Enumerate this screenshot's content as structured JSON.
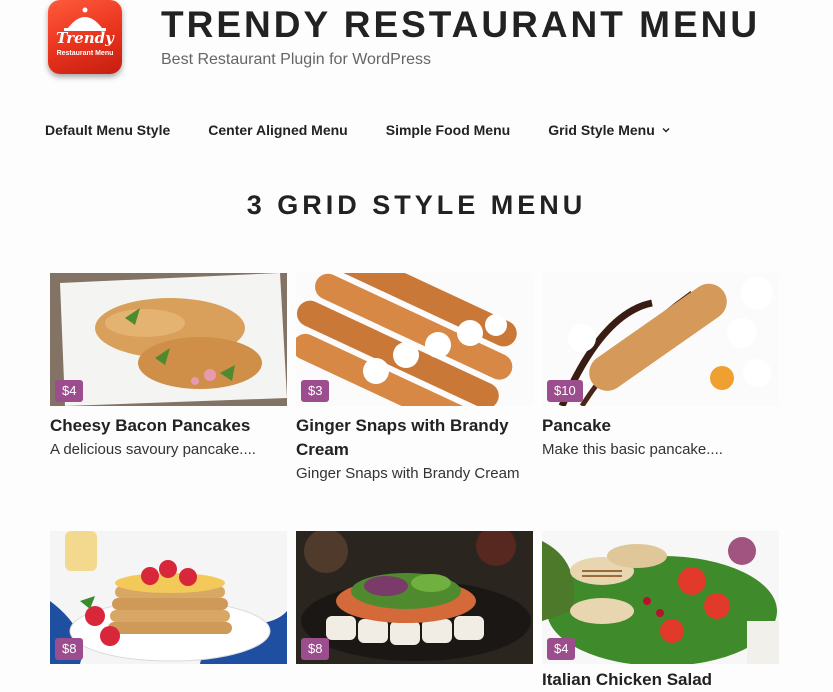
{
  "site": {
    "title": "TRENDY RESTAURANT MENU",
    "tagline": "Best Restaurant Plugin for WordPress",
    "logo_script": "Trendy",
    "logo_sub": "Restaurant Menu"
  },
  "nav": {
    "items": [
      {
        "label": "Default Menu Style"
      },
      {
        "label": "Center Aligned Menu"
      },
      {
        "label": "Simple Food Menu"
      },
      {
        "label": "Grid Style Menu",
        "has_dropdown": true
      }
    ]
  },
  "page": {
    "title": "3 GRID STYLE MENU"
  },
  "colors": {
    "price_badge": "#9b4d8e"
  },
  "menu_items": [
    {
      "title": "Cheesy Bacon Pancakes",
      "description": "A delicious savoury pancake....",
      "price": "$4",
      "image": "cheesy-bacon-pancakes-image"
    },
    {
      "title": "Ginger Snaps with Brandy Cream",
      "description": "Ginger Snaps with Brandy Cream",
      "price": "$3",
      "image": "ginger-snaps-image"
    },
    {
      "title": "Pancake",
      "description": "Make this basic pancake....",
      "price": "$10",
      "image": "pancake-image"
    },
    {
      "title": "",
      "description": "",
      "price": "$8",
      "image": "pancake-stack-raspberries-image"
    },
    {
      "title": "",
      "description": "",
      "price": "$8",
      "image": "sushi-platter-image"
    },
    {
      "title": "Italian Chicken Salad",
      "description": "",
      "price": "$4",
      "image": "italian-chicken-salad-image"
    }
  ]
}
